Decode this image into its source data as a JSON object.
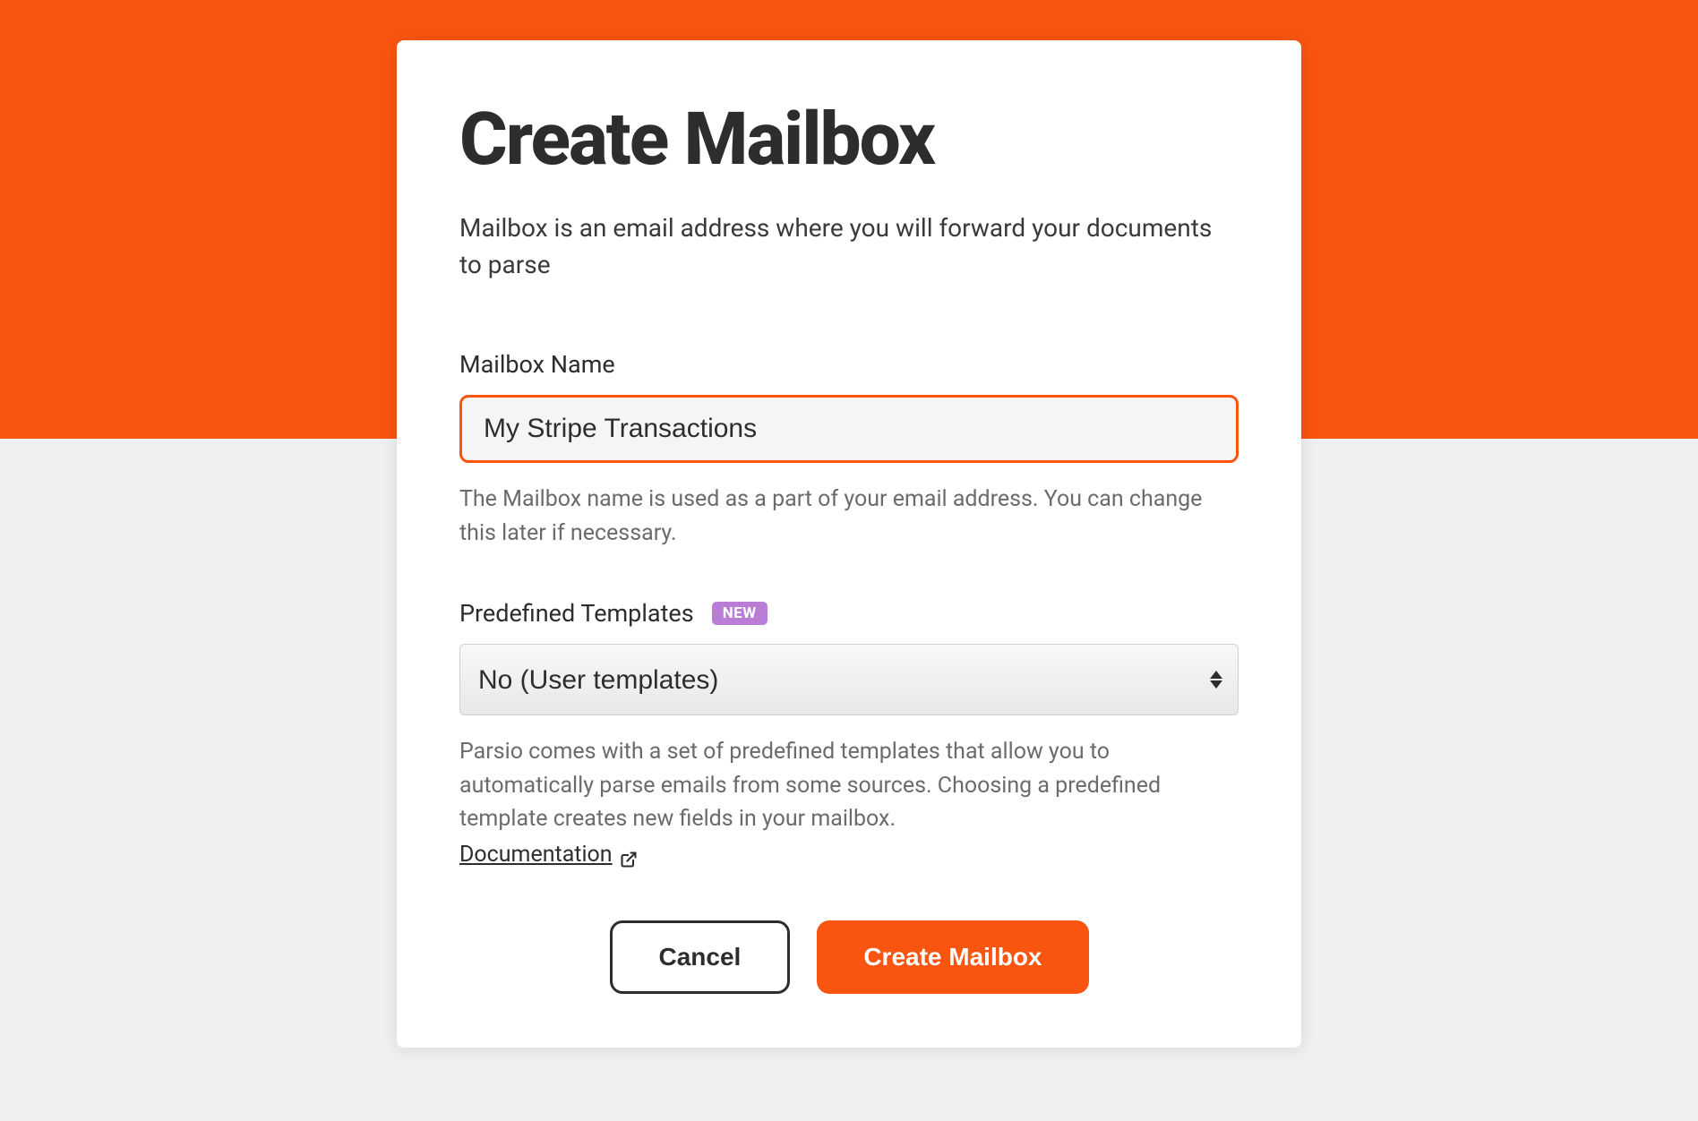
{
  "modal": {
    "title": "Create Mailbox",
    "subtitle": "Mailbox is an email address where you will forward your documents to parse",
    "mailboxName": {
      "label": "Mailbox Name",
      "value": "My Stripe Transactions",
      "help": "The Mailbox name is used as a part of your email address. You can change this later if necessary."
    },
    "templates": {
      "label": "Predefined Templates",
      "badge": "NEW",
      "selected": "No (User templates)",
      "help": "Parsio comes with a set of predefined templates that allow you to automatically parse emails from some sources. Choosing a predefined template creates new fields in your mailbox.",
      "docLink": "Documentation"
    },
    "buttons": {
      "cancel": "Cancel",
      "create": "Create Mailbox"
    }
  },
  "colors": {
    "accent": "#f95510",
    "badge": "#b97dd5"
  }
}
